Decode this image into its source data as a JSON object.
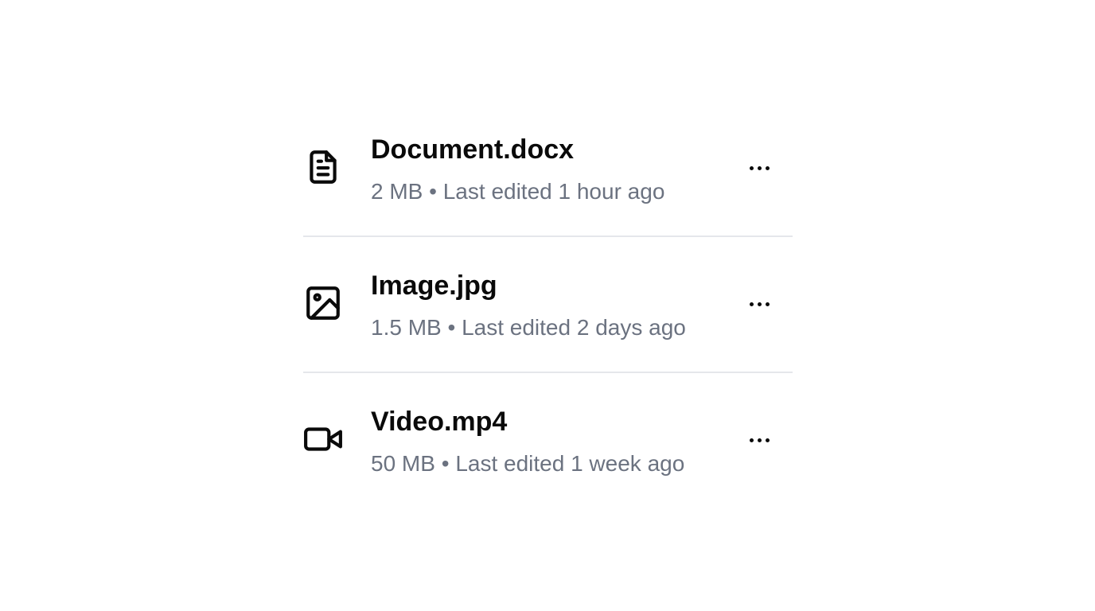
{
  "files": [
    {
      "name": "Document.docx",
      "size": "2 MB",
      "separator": "•",
      "edited": "Last edited 1 hour ago",
      "icon": "file-text-icon"
    },
    {
      "name": "Image.jpg",
      "size": "1.5 MB",
      "separator": "•",
      "edited": "Last edited 2 days ago",
      "icon": "image-icon"
    },
    {
      "name": "Video.mp4",
      "size": "50 MB",
      "separator": "•",
      "edited": "Last edited 1 week ago",
      "icon": "video-icon"
    }
  ],
  "colors": {
    "title": "#0a0a0a",
    "meta": "#6b7280",
    "divider": "#e5e7eb"
  }
}
